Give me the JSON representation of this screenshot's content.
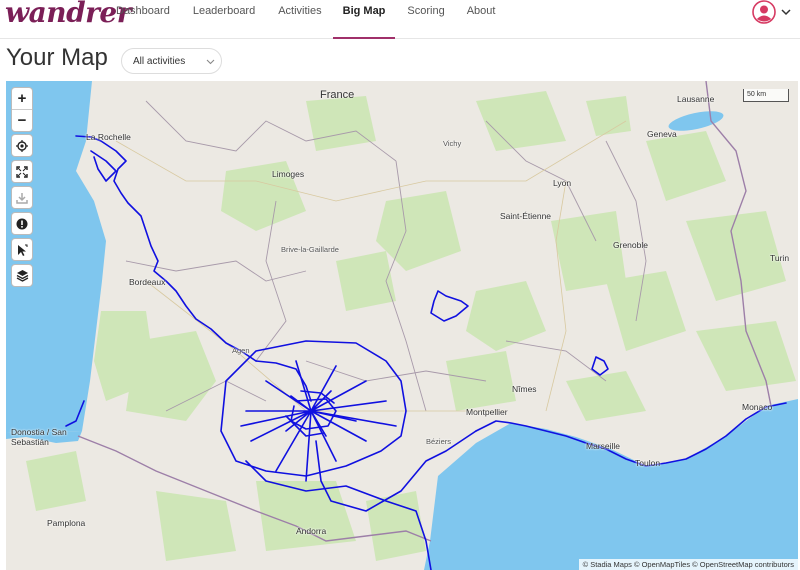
{
  "app": {
    "logo": "wandrer"
  },
  "nav": {
    "items": [
      {
        "label": "Dashboard",
        "active": false
      },
      {
        "label": "Leaderboard",
        "active": false
      },
      {
        "label": "Activities",
        "active": false
      },
      {
        "label": "Big Map",
        "active": true
      },
      {
        "label": "Scoring",
        "active": false
      },
      {
        "label": "About",
        "active": false
      }
    ]
  },
  "profile": {
    "icon": "user-icon",
    "chevron": "chevron-down-icon"
  },
  "page": {
    "title": "Your Map"
  },
  "filter": {
    "selected": "All activities"
  },
  "map": {
    "controls": [
      {
        "label": "+",
        "icon": "zoom-in-icon"
      },
      {
        "label": "−",
        "icon": "zoom-out-icon"
      },
      {
        "icon": "locate-icon"
      },
      {
        "icon": "fullscreen-icon"
      },
      {
        "icon": "download-icon"
      },
      {
        "icon": "info-icon"
      },
      {
        "icon": "select-area-icon"
      },
      {
        "icon": "layers-icon"
      }
    ],
    "scale": "50 km",
    "attribution": "© Stadia Maps © OpenMapTiles © OpenStreetMap contributors",
    "country_label": "France",
    "places": [
      "La Rochelle",
      "Limoges",
      "Vichy",
      "Lyon",
      "Geneva",
      "Lausanne",
      "Saint-Étienne",
      "Grenoble",
      "Turin",
      "Brive-la-Gaillarde",
      "Bordeaux",
      "Agen",
      "Nîmes",
      "Montpellier",
      "Béziers",
      "Marseille",
      "Toulon",
      "Monaco",
      "Donostia / San Sebastián",
      "Pamplona",
      "Andorra"
    ],
    "route_color": "#1010e0",
    "water_color": "#7fc6ee",
    "forest_color": "#cfe6b8"
  }
}
